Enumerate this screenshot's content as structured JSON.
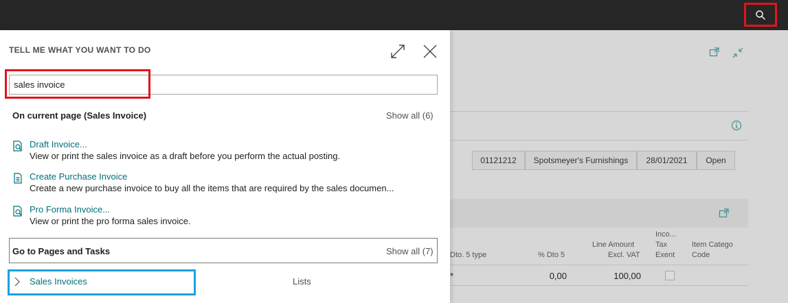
{
  "topbar": {
    "search_icon": "search-icon"
  },
  "dialog": {
    "title": "TELL ME WHAT YOU WANT TO DO",
    "search_value": "sales invoice",
    "current_page": {
      "header": "On current page (Sales Invoice)",
      "show_all": "Show all (6)",
      "items": [
        {
          "title": "Draft Invoice...",
          "description": "View or print the sales invoice as a draft before you perform the actual posting.",
          "icon": "report-search-icon"
        },
        {
          "title": "Create Purchase Invoice",
          "description": "Create a new purchase invoice to buy all the items that are required by the sales documen...",
          "icon": "document-icon"
        },
        {
          "title": "Pro Forma Invoice...",
          "description": "View or print the pro forma sales invoice.",
          "icon": "report-search-icon"
        }
      ]
    },
    "pages_tasks": {
      "header": "Go to Pages and Tasks",
      "show_all": "Show all (7)",
      "items": [
        {
          "title": "Sales Invoices",
          "category": "Lists"
        }
      ]
    }
  },
  "background": {
    "header_cells": [
      "01121212",
      "Spotsmeyer's Furnishings",
      "28/01/2021",
      "Open"
    ],
    "columns": {
      "dto5type": "Dto. 5 type",
      "pct_dto5": "% Dto 5",
      "line_amount_1": "Line Amount",
      "line_amount_2": "Excl. VAT",
      "inco_1": "Inco...",
      "inco_2": "Tax",
      "inco_3": "Exent",
      "item_cat_1": "Item Catego",
      "item_cat_2": "Code"
    },
    "row": {
      "dto5type": "*",
      "pct_dto5": "0,00",
      "line_amount": "100,00"
    }
  }
}
